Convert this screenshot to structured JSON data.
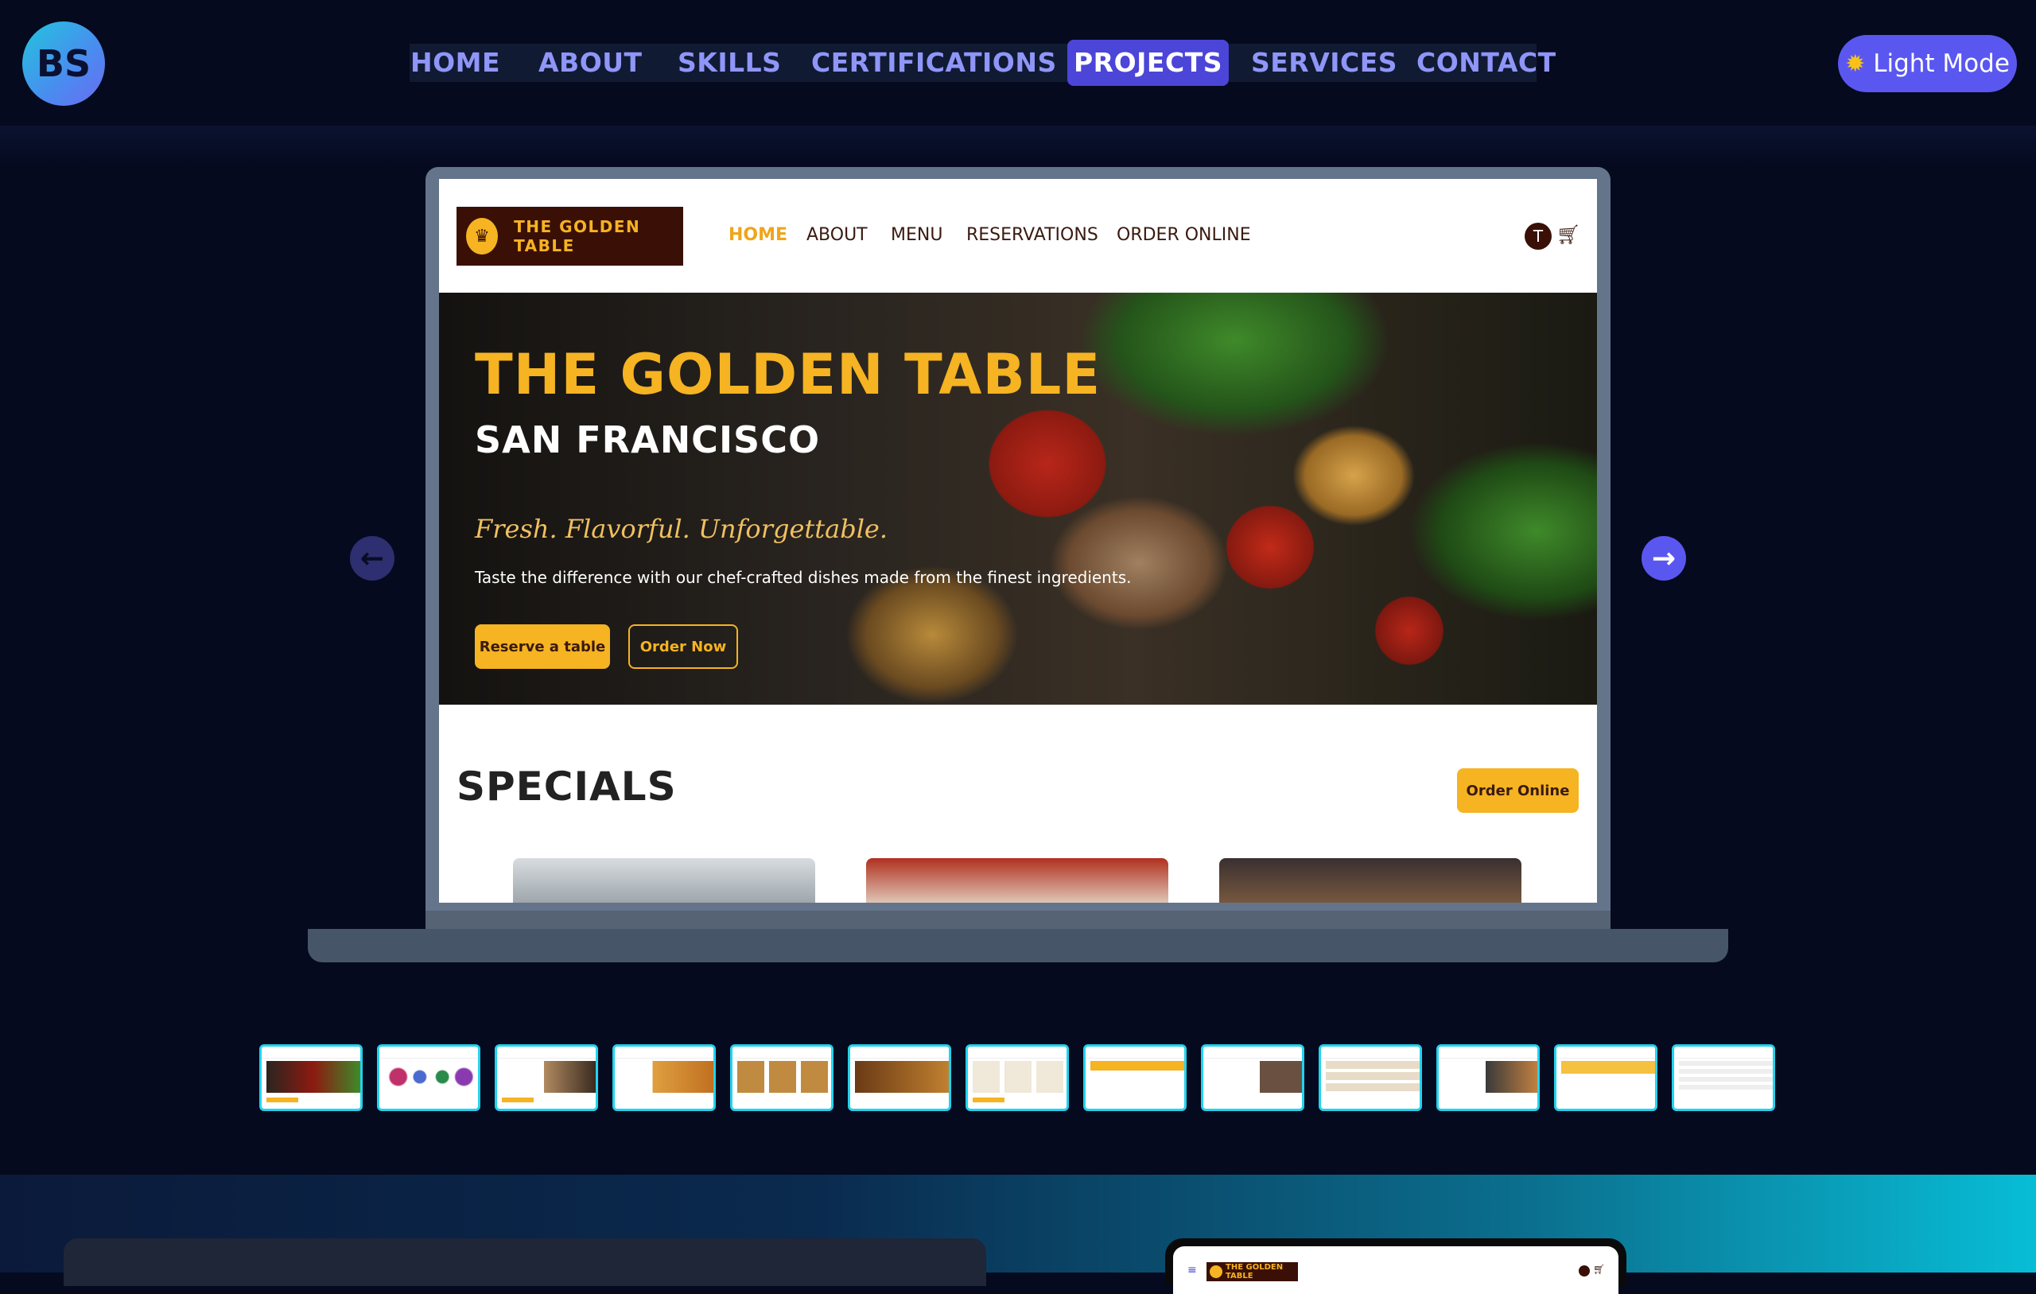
{
  "logo": {
    "text": "BS"
  },
  "nav": {
    "items": [
      {
        "label": "HOME",
        "active": false
      },
      {
        "label": "ABOUT",
        "active": false
      },
      {
        "label": "SKILLS",
        "active": false
      },
      {
        "label": "CERTIFICATIONS",
        "active": false
      },
      {
        "label": "PROJECTS",
        "active": true
      },
      {
        "label": "SERVICES",
        "active": false
      },
      {
        "label": "CONTACT",
        "active": false
      }
    ]
  },
  "theme_toggle": {
    "label": "Light Mode",
    "icon": "sun-icon"
  },
  "carousel": {
    "prev_icon": "arrow-left-icon",
    "next_icon": "arrow-right-icon",
    "thumbnail_count": 13,
    "current_index": 0
  },
  "preview_site": {
    "brand": "THE GOLDEN TABLE",
    "nav": [
      "HOME",
      "ABOUT",
      "MENU",
      "RESERVATIONS",
      "ORDER ONLINE"
    ],
    "avatar_initial": "T",
    "cart_icon": "cart-icon",
    "hero": {
      "title": "THE GOLDEN TABLE",
      "subtitle": "SAN FRANCISCO",
      "tagline": "Fresh. Flavorful. Unforgettable.",
      "description": "Taste the difference with our chef-crafted dishes made from the finest ingredients.",
      "primary_button": "Reserve a table",
      "secondary_button": "Order Now"
    },
    "specials": {
      "title": "SPECIALS",
      "button": "Order Online"
    }
  },
  "mobile_preview": {
    "brand": "THE GOLDEN TABLE",
    "menu_icon": "≡"
  },
  "colors": {
    "background": "#050a1f",
    "accent": "#5a57f0",
    "nav_text": "#8f96f8",
    "brand_gold": "#f6b322",
    "brand_brown": "#3a1006",
    "thumb_border": "#22d3ee"
  }
}
